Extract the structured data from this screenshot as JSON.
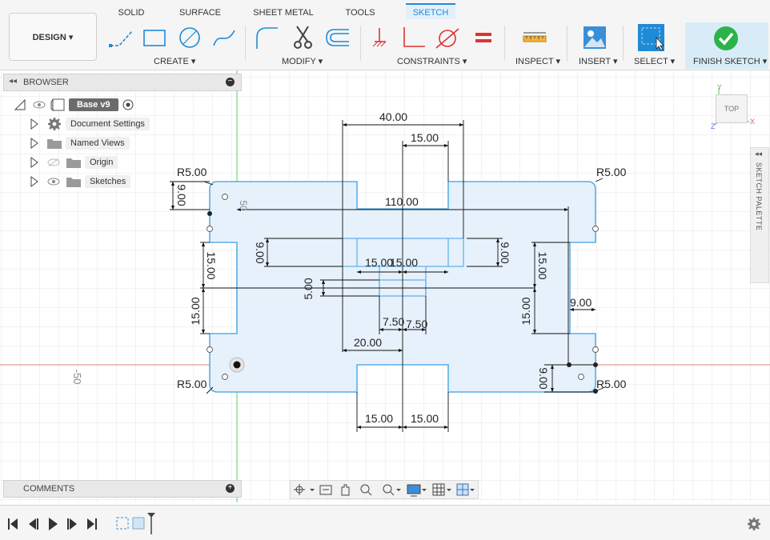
{
  "tabs": [
    {
      "label": "SOLID"
    },
    {
      "label": "SURFACE"
    },
    {
      "label": "SHEET METAL"
    },
    {
      "label": "TOOLS"
    },
    {
      "label": "SKETCH",
      "active": true
    }
  ],
  "workspace": {
    "label": "DESIGN ▾"
  },
  "groups": {
    "create": "CREATE ▾",
    "modify": "MODIFY ▾",
    "constraints": "CONSTRAINTS ▾",
    "inspect": "INSPECT ▾",
    "insert": "INSERT ▾",
    "select": "SELECT ▾",
    "finish": "FINISH SKETCH ▾"
  },
  "browser": {
    "title": "BROWSER",
    "items": [
      {
        "label": "Base v9",
        "icon": "component-icon"
      },
      {
        "label": "Document Settings",
        "icon": "gear-icon"
      },
      {
        "label": "Named Views",
        "icon": "folder-icon"
      },
      {
        "label": "Origin",
        "icon": "folder-icon"
      },
      {
        "label": "Sketches",
        "icon": "folder-icon"
      }
    ]
  },
  "comments": {
    "title": "COMMENTS"
  },
  "viewcube": {
    "label": "TOP"
  },
  "palette": {
    "label": "SKETCH PALETTE"
  },
  "axis_labels": {
    "x": "X",
    "y": "Y",
    "z": "Z"
  },
  "grid_labels": {
    "left": "-50",
    "top": "50"
  },
  "dimensions": {
    "d40": "40.00",
    "d15_top": "15.00",
    "d110": "110.00",
    "r_tl": "R5.00",
    "r_tr": "R5.00",
    "r_bl": "R5.00",
    "r_br": "R5.00",
    "d9_left": "9.00",
    "d9_inner_left": "9.00",
    "d9_inner_right": "9.00",
    "d15_left_upper": "15.00",
    "d15_left_lower": "15.00",
    "d15_right_upper": "15.00",
    "d15_right_lower": "15.00",
    "d9_right": "9.00",
    "d9_bottom_right": "9.00",
    "d15_center_left": "15.00",
    "d15_center_right": "15.00",
    "d5": "5.00",
    "d7_5_left": "7.50",
    "d7_5_right": "7.50",
    "d20": "20.00",
    "d15_bottom_left": "15.00",
    "d15_bottom_right": "15.00"
  },
  "colors": {
    "accent": "#1f8ad6",
    "profile_fill": "#e6f1fb",
    "profile_line": "#5aaee8",
    "x_axis": "#e06060",
    "y_axis": "#5cc05c",
    "finish_check": "#2bb34a"
  }
}
